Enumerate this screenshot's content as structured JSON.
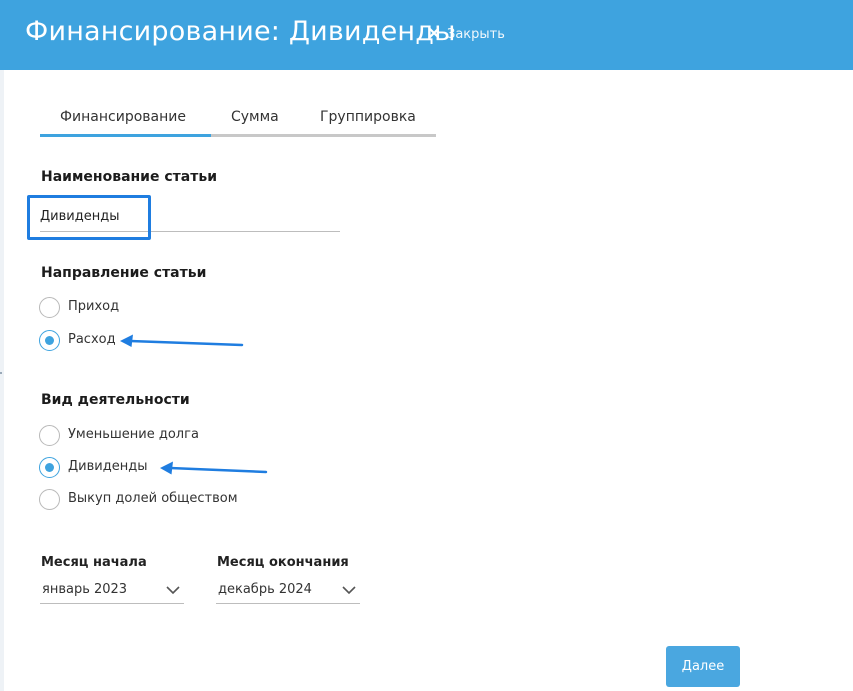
{
  "header": {
    "title": "Финансирование: Дивиденды",
    "close_label": "Закрыть",
    "background_color": "#3ea3df"
  },
  "tabs": [
    {
      "label": "Финансирование",
      "active": true
    },
    {
      "label": "Сумма",
      "active": false
    },
    {
      "label": "Группировка",
      "active": false
    }
  ],
  "article_name": {
    "title": "Наименование статьи",
    "value": "Дивиденды"
  },
  "direction": {
    "title": "Направление статьи",
    "options": [
      {
        "label": "Приход",
        "checked": false
      },
      {
        "label": "Расход",
        "checked": true
      }
    ]
  },
  "activity": {
    "title": "Вид деятельности",
    "options": [
      {
        "label": "Уменьшение долга",
        "checked": false
      },
      {
        "label": "Дивиденды",
        "checked": true
      },
      {
        "label": "Выкуп долей обществом",
        "checked": false
      }
    ]
  },
  "period": {
    "start_label": "Месяц начала",
    "start_value": "январь 2023",
    "end_label": "Месяц окончания",
    "end_value": "декабрь 2024"
  },
  "footer": {
    "next_label": "Далее"
  },
  "annotations": {
    "highlight_color": "#1f7de0",
    "arrow_color": "#1f7de0"
  }
}
